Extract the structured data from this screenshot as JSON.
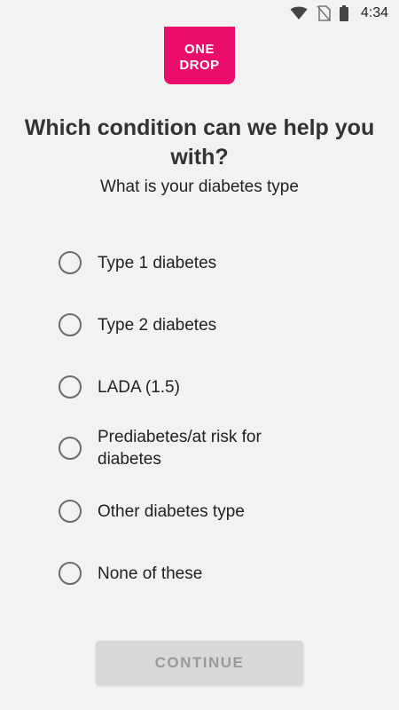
{
  "status_bar": {
    "time": "4:34",
    "icons": [
      "wifi-icon",
      "no-sim-icon",
      "battery-icon"
    ]
  },
  "logo": {
    "line1": "ONE",
    "line2": "DROP",
    "color": "#ec0c6c"
  },
  "header": {
    "title": "Which condition can we help you with?",
    "subtitle": "What is your diabetes type"
  },
  "options": [
    {
      "label": "Type 1 diabetes",
      "selected": false
    },
    {
      "label": "Type 2 diabetes",
      "selected": false
    },
    {
      "label": "LADA (1.5)",
      "selected": false
    },
    {
      "label": "Prediabetes/at risk for diabetes",
      "selected": false
    },
    {
      "label": "Other diabetes type",
      "selected": false
    },
    {
      "label": "None of these",
      "selected": false
    }
  ],
  "continue_button": {
    "label": "CONTINUE",
    "enabled": false
  }
}
